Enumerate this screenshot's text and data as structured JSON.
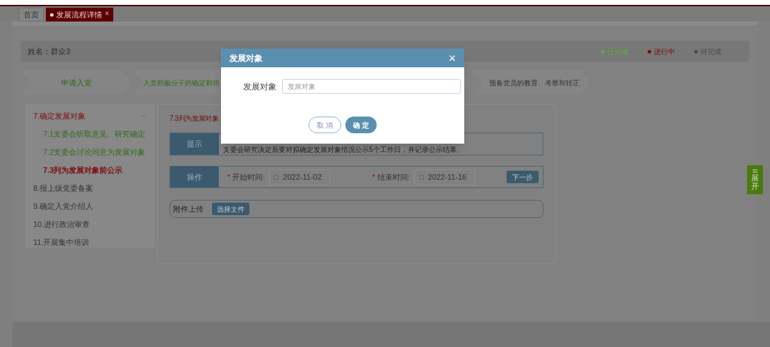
{
  "tabs": [
    {
      "label": "首页",
      "selected": false
    },
    {
      "label": "发展流程详情",
      "selected": true,
      "close": "×"
    }
  ],
  "person": {
    "name": "姓名：群众3"
  },
  "legend": [
    {
      "label": "已完成",
      "color": "#5fae3a"
    },
    {
      "label": "进行中",
      "color": "#7d0a0a"
    },
    {
      "label": "待完成",
      "color": "#4a4a4a"
    }
  ],
  "steps": [
    {
      "label": "申请入党",
      "color": "#2f6a1a"
    },
    {
      "label": "入党积极分子的确定和培",
      "color": "#2f6a1a"
    },
    {
      "label": "预备党员的教育、考察和转正",
      "color": "#333333"
    }
  ],
  "sidebar": {
    "items": [
      {
        "label": "7.确定发展对象",
        "color": "#7d0a0a",
        "selected": false,
        "expanded": true,
        "children": [
          {
            "label": "7.1支委会听取意见、研究确定",
            "color": "#2f6a1a",
            "selected": false
          },
          {
            "label": "7.2支委会讨论同意为发展对象",
            "color": "#2f6a1a",
            "selected": false
          },
          {
            "label": "7.3列为发展对象前公示",
            "color": "#7d0a0a",
            "selected": true
          }
        ]
      },
      {
        "label": "8.报上级党委备案",
        "color": "#333333",
        "selected": false
      },
      {
        "label": "9.确定入党介绍人",
        "color": "#333333",
        "selected": false
      },
      {
        "label": "10.进行政治审查",
        "color": "#333333",
        "selected": false
      },
      {
        "label": "11.开展集中培训",
        "color": "#333333",
        "selected": false
      }
    ]
  },
  "content": {
    "title": "7.3列为发展对象",
    "hint": {
      "label": "提示",
      "text": "支委会研究决定后要对拟确定发展对象情况公示5个工作日，并记录公示结果。"
    },
    "operation": {
      "label": "操作",
      "required_mark": "*",
      "start_label": "开始时间:",
      "start_value": "2022-11-02",
      "end_label": "结束时间:",
      "end_value": "2022-11-16",
      "next": "下一步"
    },
    "attachment": {
      "label": "附件上传",
      "button": "选择文件"
    }
  },
  "expand_tab": {
    "label": "展开"
  },
  "modal": {
    "title": "发展对象",
    "close": "×",
    "field_label": "发展对象",
    "placeholder": "发展对象",
    "cancel": "取 消",
    "confirm": "确 定"
  }
}
